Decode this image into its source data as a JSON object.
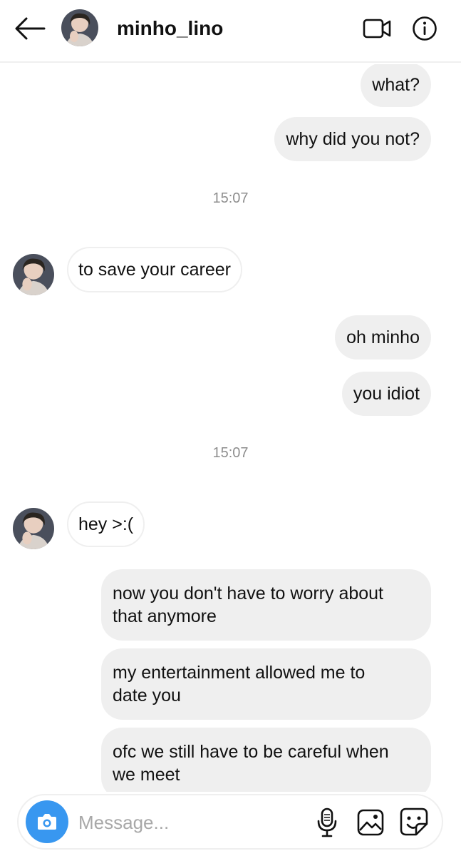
{
  "header": {
    "username": "minho_lino",
    "icons": [
      "arrow-left-icon",
      "avatar",
      "video-camera-icon",
      "info-icon"
    ]
  },
  "thread": {
    "messages": [
      {
        "direction": "outgoing",
        "text": "what?"
      },
      {
        "direction": "outgoing",
        "text": "why did you not?"
      },
      {
        "type": "timestamp",
        "text": "15:07"
      },
      {
        "direction": "incoming",
        "text": "to save your career"
      },
      {
        "direction": "outgoing",
        "text": "oh minho"
      },
      {
        "direction": "outgoing",
        "text": "you idiot"
      },
      {
        "type": "timestamp",
        "text": "15:07"
      },
      {
        "direction": "incoming",
        "text": "hey >:("
      },
      {
        "direction": "outgoing",
        "line1": "now you don't have to worry about",
        "line2": "that anymore"
      },
      {
        "direction": "outgoing",
        "line1": "my entertainment allowed me to",
        "line2": "date you"
      },
      {
        "direction": "outgoing",
        "line1": "ofc we still have to be careful when",
        "line2": "we meet"
      }
    ]
  },
  "composer": {
    "placeholder": "Message...",
    "value": "",
    "icons": [
      "camera-icon",
      "microphone-icon",
      "gallery-icon",
      "sticker-icon"
    ],
    "camera_color": "#3897f0"
  },
  "colors": {
    "outgoing_bubble": "#efefef",
    "incoming_border": "#efefef",
    "timestamp": "#8e8e8e",
    "accent": "#3897f0"
  }
}
